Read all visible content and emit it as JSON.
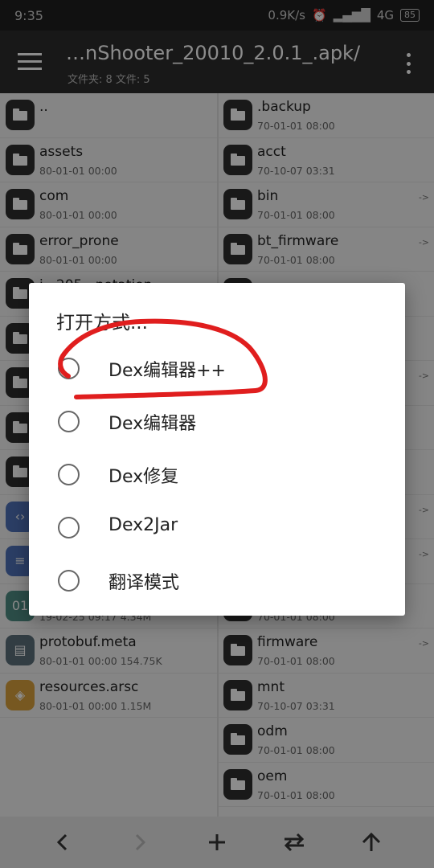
{
  "status": {
    "time": "9:35",
    "speed": "0.9K/s",
    "network": "4G",
    "battery": "85"
  },
  "appbar": {
    "title": "…nShooter_20010_2.0.1_.apk/",
    "subtitle": "文件夹: 8  文件: 5"
  },
  "left_pane": [
    {
      "name": "..",
      "meta": ""
    },
    {
      "name": "assets",
      "meta": "80-01-01 00:00"
    },
    {
      "name": "com",
      "meta": "80-01-01 00:00"
    },
    {
      "name": "error_prone",
      "meta": "80-01-01 00:00"
    },
    {
      "name": "j...205...notation",
      "meta": ""
    },
    {
      "name": "",
      "meta": ""
    },
    {
      "name": "",
      "meta": ""
    },
    {
      "name": "",
      "meta": ""
    },
    {
      "name": "",
      "meta": ""
    },
    {
      "name": "",
      "meta": ""
    },
    {
      "name": "",
      "meta": ""
    },
    {
      "name": "",
      "meta": "",
      "meta2": "19-02-25 09:17  4.34M"
    },
    {
      "name": "protobuf.meta",
      "meta": "80-01-01 00:00  154.75K"
    },
    {
      "name": "resources.arsc",
      "meta": "80-01-01 00:00  1.15M"
    }
  ],
  "right_pane": [
    {
      "name": ".backup",
      "meta": "70-01-01 08:00",
      "link": ""
    },
    {
      "name": "acct",
      "meta": "70-10-07 03:31",
      "link": ""
    },
    {
      "name": "bin",
      "meta": "70-01-01 08:00",
      "link": "->"
    },
    {
      "name": "bt_firmware",
      "meta": "70-01-01 08:00",
      "link": "->"
    },
    {
      "name": "",
      "meta": "",
      "link": ""
    },
    {
      "name": "",
      "meta": "",
      "link": ""
    },
    {
      "name": "",
      "meta": "",
      "link": "->"
    },
    {
      "name": "",
      "meta": "",
      "link": ""
    },
    {
      "name": "",
      "meta": "",
      "link": ""
    },
    {
      "name": "",
      "meta": "",
      "link": "->"
    },
    {
      "name": "",
      "meta": "",
      "link": "->"
    },
    {
      "name": "",
      "meta": "70-01-01 08:00",
      "link": ""
    },
    {
      "name": "firmware",
      "meta": "70-01-01 08:00",
      "link": "->"
    },
    {
      "name": "mnt",
      "meta": "70-10-07 03:31",
      "link": ""
    },
    {
      "name": "odm",
      "meta": "70-01-01 08:00",
      "link": ""
    },
    {
      "name": "oem",
      "meta": "70-01-01 08:00",
      "link": ""
    }
  ],
  "dialog": {
    "title": "打开方式...",
    "options": [
      "Dex编辑器++",
      "Dex编辑器",
      "Dex修复",
      "Dex2Jar",
      "翻译模式"
    ]
  },
  "colors": {
    "annotation": "#e01e1e",
    "accent_dark": "#2c2c2c"
  },
  "icons": {
    "bottom": [
      "back-icon",
      "forward-icon",
      "add-icon",
      "swap-icon",
      "up-icon"
    ]
  }
}
